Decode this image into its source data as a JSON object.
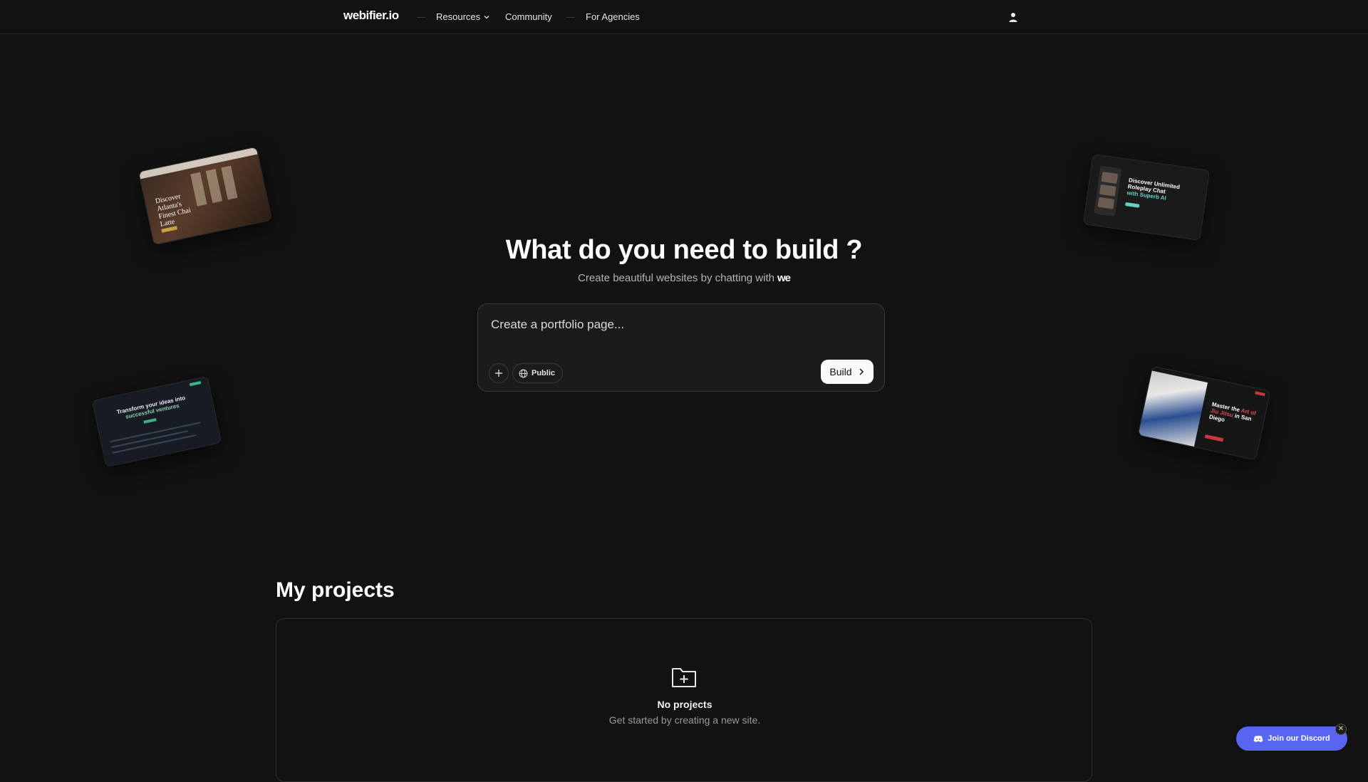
{
  "nav": {
    "logo": "webifier.io",
    "items": [
      {
        "label": "Resources",
        "has_dropdown": true
      },
      {
        "label": "Community"
      },
      {
        "label": "For Agencies"
      }
    ],
    "user_icon": "user-icon"
  },
  "previews": {
    "cafe": {
      "text": "Discover Atlanta's Finest Chai Latte"
    },
    "chat": {
      "text_a": "Discover Unlimited Roleplay Chat",
      "text_b": "with Superb AI"
    },
    "ventures": {
      "text_a": "Transform your ideas into",
      "text_b": "successful ventures"
    },
    "jiujitsu": {
      "text_a": "Master the",
      "text_b": "Art of Jiu Jitsu",
      "text_c": "in San Diego"
    }
  },
  "hero": {
    "title": "What do you need to build ?",
    "subtitle": "Create beautiful websites by chatting with",
    "subtitle_brand": "we"
  },
  "prompt": {
    "placeholder": "Create a portfolio page...",
    "value": "",
    "add_icon": "plus-icon",
    "visibility_icon": "globe-icon",
    "visibility_label": "Public",
    "build_label": "Build",
    "build_icon": "chevron-right-icon"
  },
  "projects": {
    "title": "My projects",
    "empty_icon": "folder-plus-icon",
    "empty_title": "No projects",
    "empty_subtitle": "Get started by creating a new site."
  },
  "discord": {
    "label": "Join our Discord",
    "icon": "discord-icon",
    "close_icon": "close-icon",
    "color": "#5865f2"
  },
  "colors": {
    "background": "#121212",
    "panel": "#1b1b1b",
    "border": "#3a3a3a"
  }
}
